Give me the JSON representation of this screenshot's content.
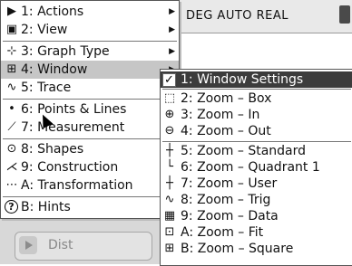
{
  "status_bar": {
    "mode": "DEG AUTO REAL"
  },
  "entry_line": {
    "value": "Dist"
  },
  "menu": {
    "items": [
      {
        "key": "1",
        "label": "1: Actions",
        "icon": "arrow-pointer-icon",
        "glyph": "▶",
        "submenu": true
      },
      {
        "key": "2",
        "label": "2: View",
        "icon": "view-icon",
        "glyph": "▣",
        "submenu": true
      },
      {
        "key": "3",
        "label": "3: Graph Type",
        "icon": "graph-type-icon",
        "glyph": "⊹",
        "submenu": true
      },
      {
        "key": "4",
        "label": "4: Window",
        "icon": "window-icon",
        "glyph": "⊞",
        "submenu": true,
        "highlighted": true
      },
      {
        "key": "5",
        "label": "5: Trace",
        "icon": "trace-icon",
        "glyph": "∿",
        "submenu": true
      },
      {
        "key": "6",
        "label": "6: Points & Lines",
        "icon": "points-lines-icon",
        "glyph": "•",
        "submenu": true
      },
      {
        "key": "7",
        "label": "7: Measurement",
        "icon": "measurement-icon",
        "glyph": "⟋",
        "submenu": true
      },
      {
        "key": "8",
        "label": "8: Shapes",
        "icon": "shapes-icon",
        "glyph": "⊙",
        "submenu": true
      },
      {
        "key": "9",
        "label": "9: Construction",
        "icon": "construction-icon",
        "glyph": "⋌",
        "submenu": true
      },
      {
        "key": "A",
        "label": "A: Transformation",
        "icon": "transformation-icon",
        "glyph": "⋯",
        "submenu": true
      },
      {
        "key": "B",
        "label": "B: Hints",
        "icon": "hints-icon",
        "glyph": "?",
        "submenu": false
      }
    ]
  },
  "submenu": {
    "items": [
      {
        "label": "1: Window Settings",
        "icon": "window-settings-icon",
        "glyph": "✓",
        "highlighted": true
      },
      {
        "label": "2: Zoom – Box",
        "icon": "zoom-box-icon",
        "glyph": "⬚"
      },
      {
        "label": "3: Zoom – In",
        "icon": "zoom-in-icon",
        "glyph": "⊕"
      },
      {
        "label": "4: Zoom – Out",
        "icon": "zoom-out-icon",
        "glyph": "⊖"
      },
      {
        "label": "5: Zoom – Standard",
        "icon": "zoom-standard-icon",
        "glyph": "┼"
      },
      {
        "label": "6: Zoom – Quadrant 1",
        "icon": "zoom-quadrant-icon",
        "glyph": "└"
      },
      {
        "label": "7: Zoom – User",
        "icon": "zoom-user-icon",
        "glyph": "┼"
      },
      {
        "label": "8: Zoom – Trig",
        "icon": "zoom-trig-icon",
        "glyph": "∿"
      },
      {
        "label": "9: Zoom – Data",
        "icon": "zoom-data-icon",
        "glyph": "▦"
      },
      {
        "label": "A: Zoom – Fit",
        "icon": "zoom-fit-icon",
        "glyph": "⊡"
      },
      {
        "label": "B: Zoom – Square",
        "icon": "zoom-square-icon",
        "glyph": "⊞"
      }
    ]
  }
}
